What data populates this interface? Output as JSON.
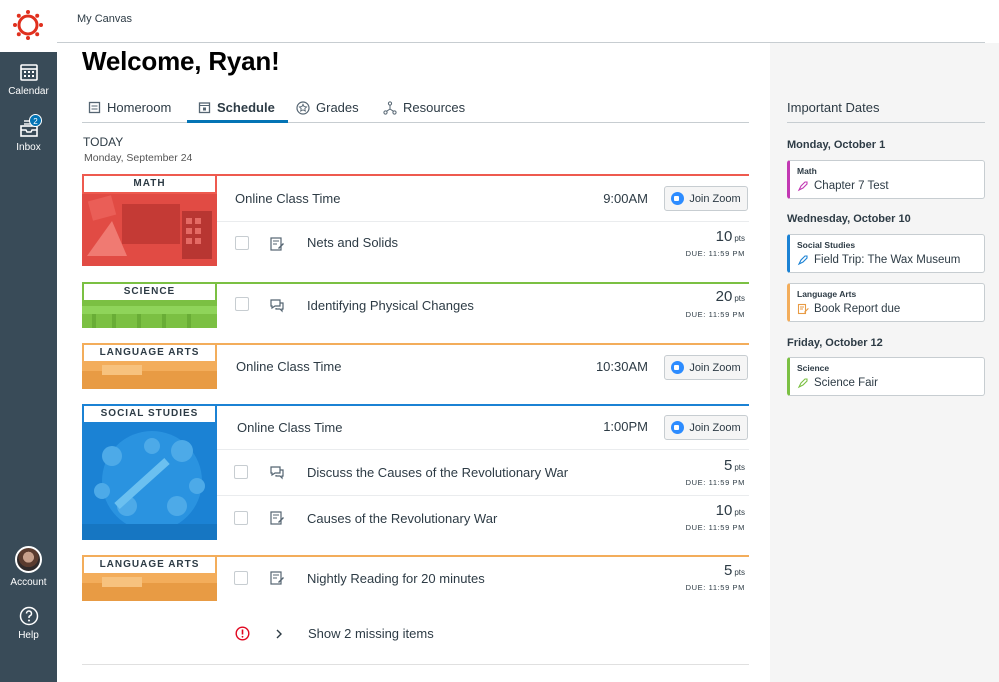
{
  "nav": {
    "calendar": "Calendar",
    "inbox": "Inbox",
    "inbox_badge": "2",
    "account": "Account",
    "help": "Help"
  },
  "breadcrumb": "My Canvas",
  "welcome": "Welcome, Ryan!",
  "tabs": [
    {
      "label": "Homeroom",
      "icon": "home-icon"
    },
    {
      "label": "Schedule",
      "icon": "calendar-icon",
      "active": true
    },
    {
      "label": "Grades",
      "icon": "star-icon"
    },
    {
      "label": "Resources",
      "icon": "network-icon"
    }
  ],
  "today_label": "TODAY",
  "today_date": "Monday, September 24",
  "subjects": {
    "math": {
      "label": "MATH",
      "color": "#ee5a4f"
    },
    "science": {
      "label": "SCIENCE",
      "color": "#7bc043"
    },
    "lang1": {
      "label": "LANGUAGE ARTS",
      "color": "#f3ad5b"
    },
    "social": {
      "label": "SOCIAL STUDIES",
      "color": "#1b82d4"
    },
    "lang2": {
      "label": "LANGUAGE ARTS",
      "color": "#f3ad5b"
    }
  },
  "rows": {
    "math_class": {
      "title": "Online Class Time",
      "time": "9:00AM",
      "button": "Join Zoom"
    },
    "math_task": {
      "title": "Nets and Solids",
      "pts": "10",
      "pts_unit": "pts",
      "due": "DUE: 11:59 PM"
    },
    "sci_task": {
      "title": "Identifying Physical Changes",
      "pts": "20",
      "pts_unit": "pts",
      "due": "DUE: 11:59 PM"
    },
    "lang_class": {
      "title": "Online Class Time",
      "time": "10:30AM",
      "button": "Join Zoom"
    },
    "soc_class": {
      "title": "Online Class Time",
      "time": "1:00PM",
      "button": "Join Zoom"
    },
    "soc_task1": {
      "title": "Discuss the Causes of the Revolutionary War",
      "pts": "5",
      "pts_unit": "pts",
      "due": "DUE: 11:59 PM"
    },
    "soc_task2": {
      "title": "Causes of the Revolutionary War",
      "pts": "10",
      "pts_unit": "pts",
      "due": "DUE: 11:59 PM"
    },
    "lang2_task": {
      "title": "Nightly Reading for 20 minutes",
      "pts": "5",
      "pts_unit": "pts",
      "due": "DUE: 11:59 PM"
    }
  },
  "missing": "Show 2 missing items",
  "important": {
    "title": "Important Dates",
    "days": [
      {
        "day": "Monday, October 1",
        "items": [
          {
            "subject": "Math",
            "text": "Chapter 7 Test",
            "color": "#c238b3",
            "icon": "rocket-icon"
          }
        ]
      },
      {
        "day": "Wednesday, October 10",
        "items": [
          {
            "subject": "Social Studies",
            "text": "Field Trip: The Wax Museum",
            "color": "#1b82d4",
            "icon": "rocket-icon"
          },
          {
            "subject": "Language Arts",
            "text": "Book Report due",
            "color": "#f3ad5b",
            "icon": "assignment-icon"
          }
        ]
      },
      {
        "day": "Friday, October 12",
        "items": [
          {
            "subject": "Science",
            "text": "Science Fair",
            "color": "#7bc043",
            "icon": "rocket-icon"
          }
        ]
      }
    ]
  }
}
